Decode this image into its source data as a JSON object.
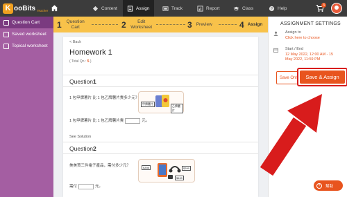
{
  "brand": {
    "logo_k": "K",
    "name": "ooBits",
    "sub": "Teacher"
  },
  "nav": {
    "items": [
      {
        "label": "Content",
        "icon": "content-icon"
      },
      {
        "label": "Assign",
        "icon": "assign-icon",
        "active": true
      },
      {
        "label": "Track",
        "icon": "track-icon"
      },
      {
        "label": "Report",
        "icon": "report-icon"
      },
      {
        "label": "Class",
        "icon": "class-icon"
      },
      {
        "label": "Help",
        "icon": "help-icon"
      }
    ],
    "cart_count": "3"
  },
  "sidebar": {
    "items": [
      {
        "label": "Question Cart",
        "active": true
      },
      {
        "label": "Saved worksheet"
      },
      {
        "label": "Topical worksheet"
      }
    ]
  },
  "steps": [
    {
      "num": "1",
      "label": "Question Cart"
    },
    {
      "num": "2",
      "label": "Edit Worksheet"
    },
    {
      "num": "3",
      "label": "Preview"
    },
    {
      "num": "4",
      "label": "Assign",
      "active": true
    }
  ],
  "worksheet": {
    "back": "< Back",
    "title": "Homework 1",
    "total_prefix": "( Total Qn : ",
    "total_count": "5",
    "total_suffix": " )",
    "see_solution": "See Solution",
    "questions": [
      {
        "label": "Question",
        "num": "1",
        "text": "1 包甲牌薯片 比 1 包乙牌薯片貴多少元？",
        "answer_prefix": "1 包甲牌薯片 比 1 包乙牌薯片貴",
        "answer_suffix": "元。",
        "img_tags": [
          "甲牌薯片",
          "乙牌薯片"
        ]
      },
      {
        "label": "Question",
        "num": "2",
        "text": "美美買三件電子產品，需付多少元？",
        "answer_prefix": "需付",
        "answer_suffix": "元。",
        "img_tags": [
          "$398",
          "$399",
          "$469"
        ]
      }
    ]
  },
  "assignment": {
    "heading": "ASSIGNMENT SETTINGS",
    "assign_to_label": "Assign to",
    "assign_to_link": "Click here to choose",
    "start_end_label": "Start / End",
    "start": "12 May 2022, 12:00 AM - 15",
    "end": "May 2022, 11:59 PM",
    "save_only": "Save Only",
    "save_assign": "Save & Assign"
  },
  "help": {
    "label": "幫助"
  },
  "colors": {
    "accent": "#e8541e",
    "purple": "#a45ea2",
    "step_yellow": "#f8c24a",
    "annotation_red": "#d81c1c"
  }
}
